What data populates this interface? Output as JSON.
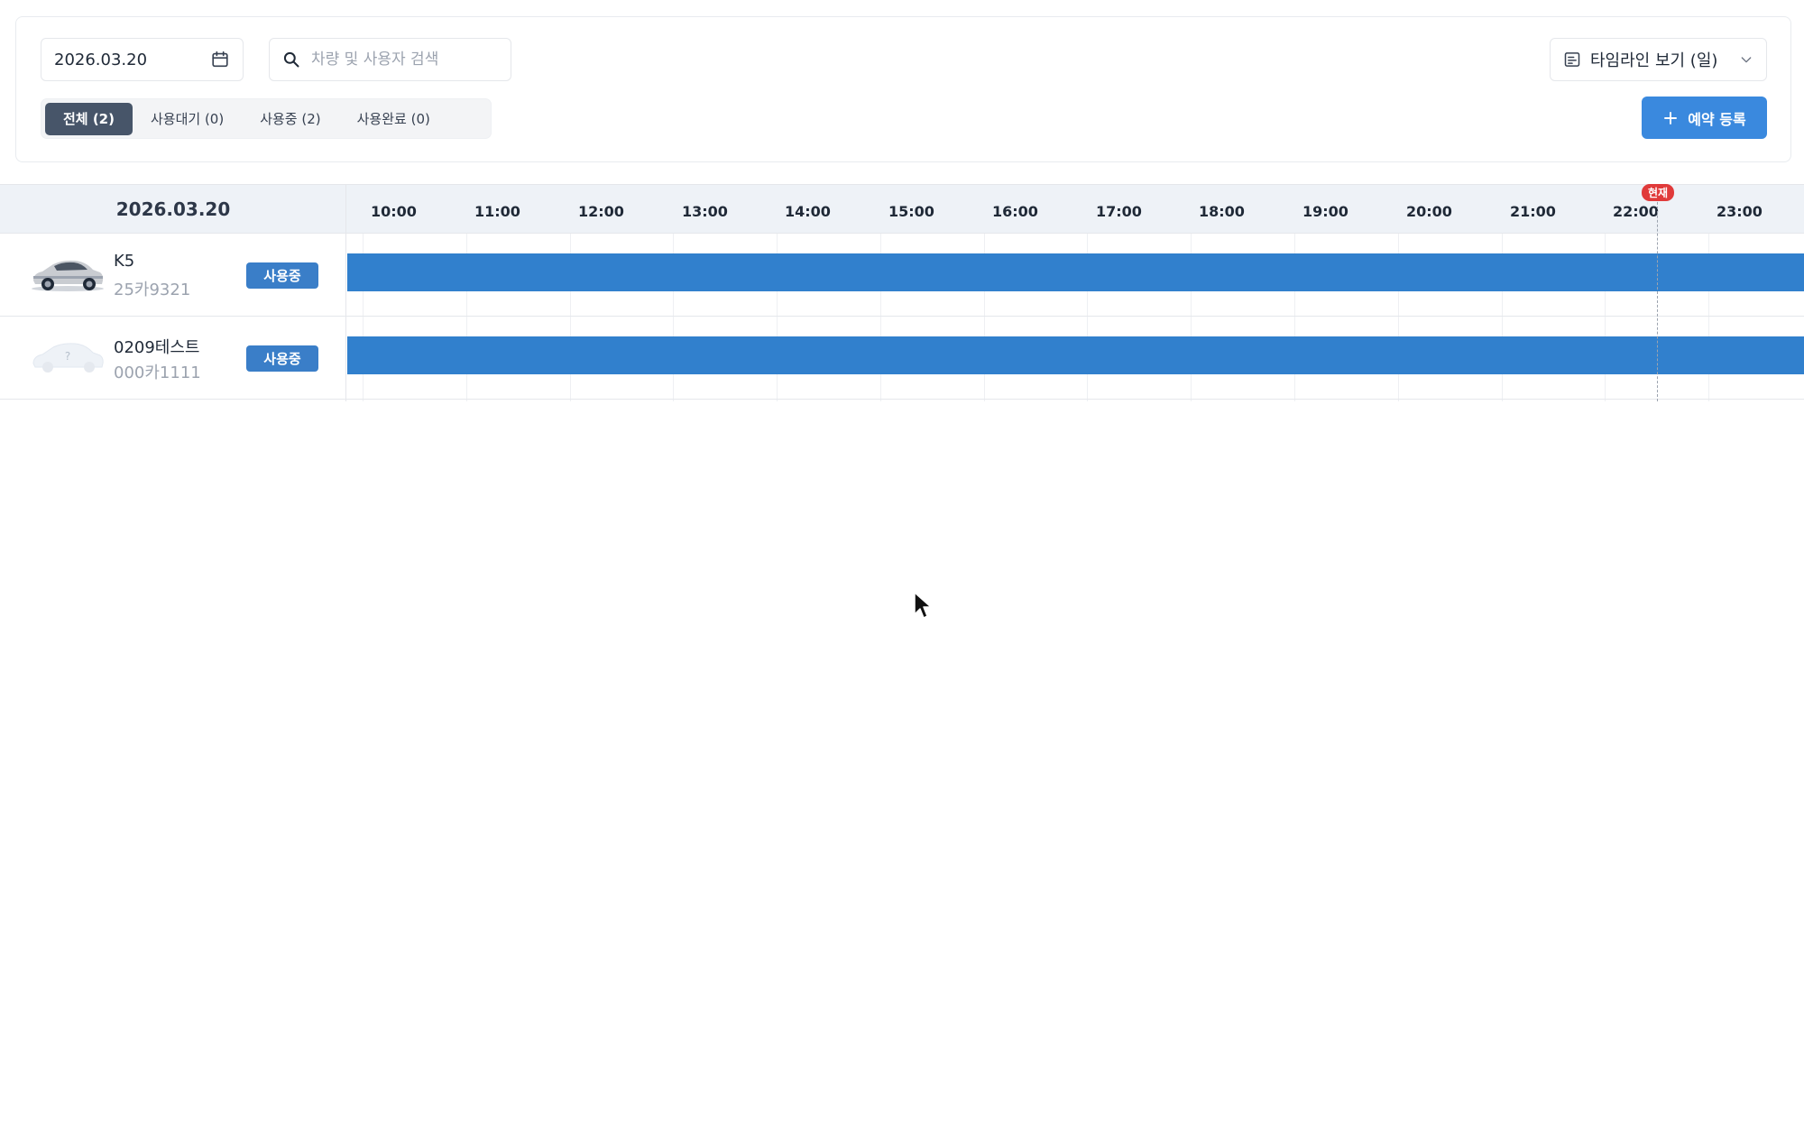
{
  "filters": {
    "date": "2026.03.20",
    "search_placeholder": "차량 및 사용자 검색",
    "view_mode": "타임라인 보기 (일)",
    "tabs": [
      {
        "label": "전체 (2)",
        "active": true
      },
      {
        "label": "사용대기 (0)",
        "active": false
      },
      {
        "label": "사용중 (2)",
        "active": false
      },
      {
        "label": "사용완료 (0)",
        "active": false
      }
    ],
    "add_button_label": "예약 등록"
  },
  "timeline": {
    "date": "2026.03.20",
    "hours": [
      "10:00",
      "11:00",
      "12:00",
      "13:00",
      "14:00",
      "15:00",
      "16:00",
      "17:00",
      "18:00",
      "19:00",
      "20:00",
      "21:00",
      "22:00",
      "23:00"
    ],
    "now_label": "현재",
    "rows": [
      {
        "name": "K5",
        "plate": "25카9321",
        "status": "사용중",
        "has_photo": true
      },
      {
        "name": "0209테스트",
        "plate": "000카1111",
        "status": "사용중",
        "has_photo": false
      }
    ]
  },
  "colors": {
    "accent": "#3a89de",
    "bar": "#3180cd",
    "active_tab": "#475569",
    "now_badge": "#e03a3a"
  }
}
